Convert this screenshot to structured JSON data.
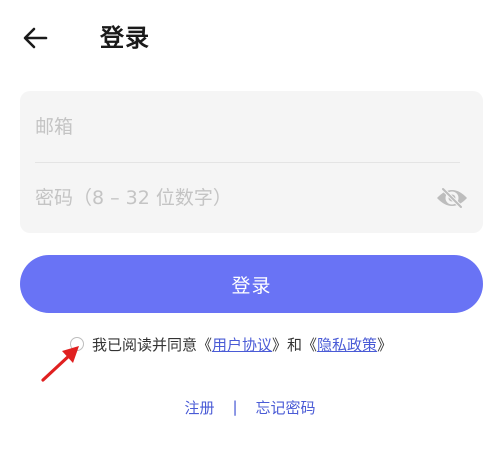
{
  "header": {
    "title": "登录",
    "back_icon": "arrow-left-icon"
  },
  "form": {
    "email": {
      "placeholder": "邮箱",
      "value": ""
    },
    "password": {
      "placeholder": "密码（8 – 32 位数字）",
      "value": ""
    },
    "visibility_icon": "eye-off-icon"
  },
  "login_button": {
    "label": "登录"
  },
  "agreement": {
    "prefix": "我已阅读并同意《",
    "user_agreement": "用户协议",
    "middle": "》和《",
    "privacy_policy": "隐私政策",
    "suffix": "》",
    "checked": false
  },
  "links": {
    "register": "注册",
    "separator": "|",
    "forgot_password": "忘记密码"
  },
  "colors": {
    "primary": "#6973f5",
    "link": "#4a5bd6",
    "annotation_arrow": "#e02020",
    "field_background": "#f5f5f5"
  }
}
